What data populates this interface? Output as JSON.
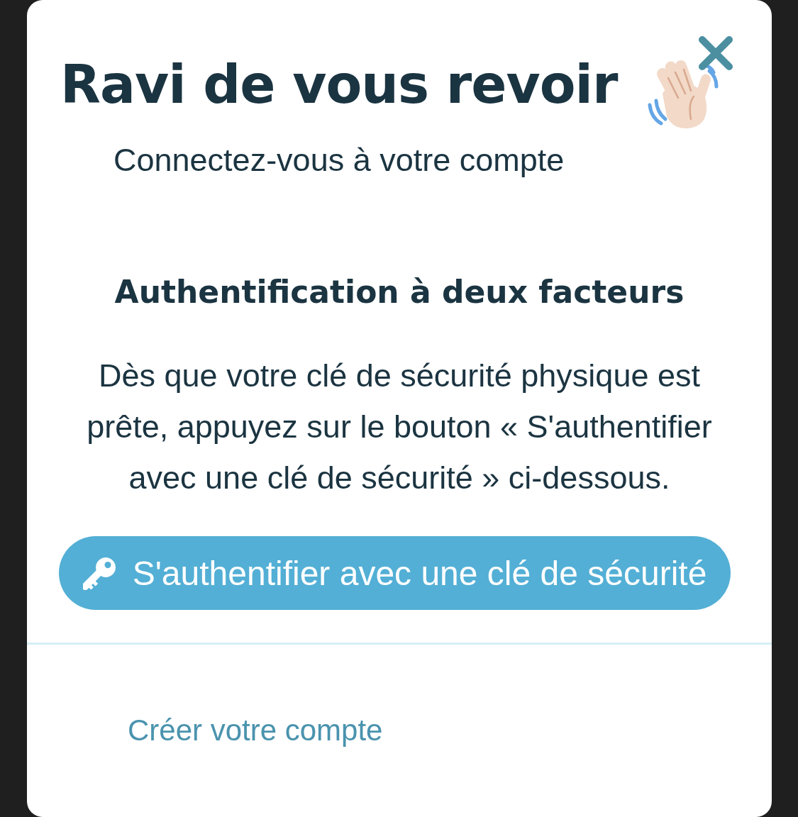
{
  "dialog": {
    "title": "Ravi de vous revoir",
    "subtitle": "Connectez-vous à votre compte"
  },
  "two_factor": {
    "heading": "Authentification à deux facteurs",
    "instructions": "Dès que votre clé de sécurité physique est prête, appuyez sur le bouton « S'authentifier avec une clé de sécurité » ci-dessous.",
    "button": {
      "label": "S'authentifier avec une clé de sécurité"
    }
  },
  "footer": {
    "link": "Créer votre compte"
  }
}
